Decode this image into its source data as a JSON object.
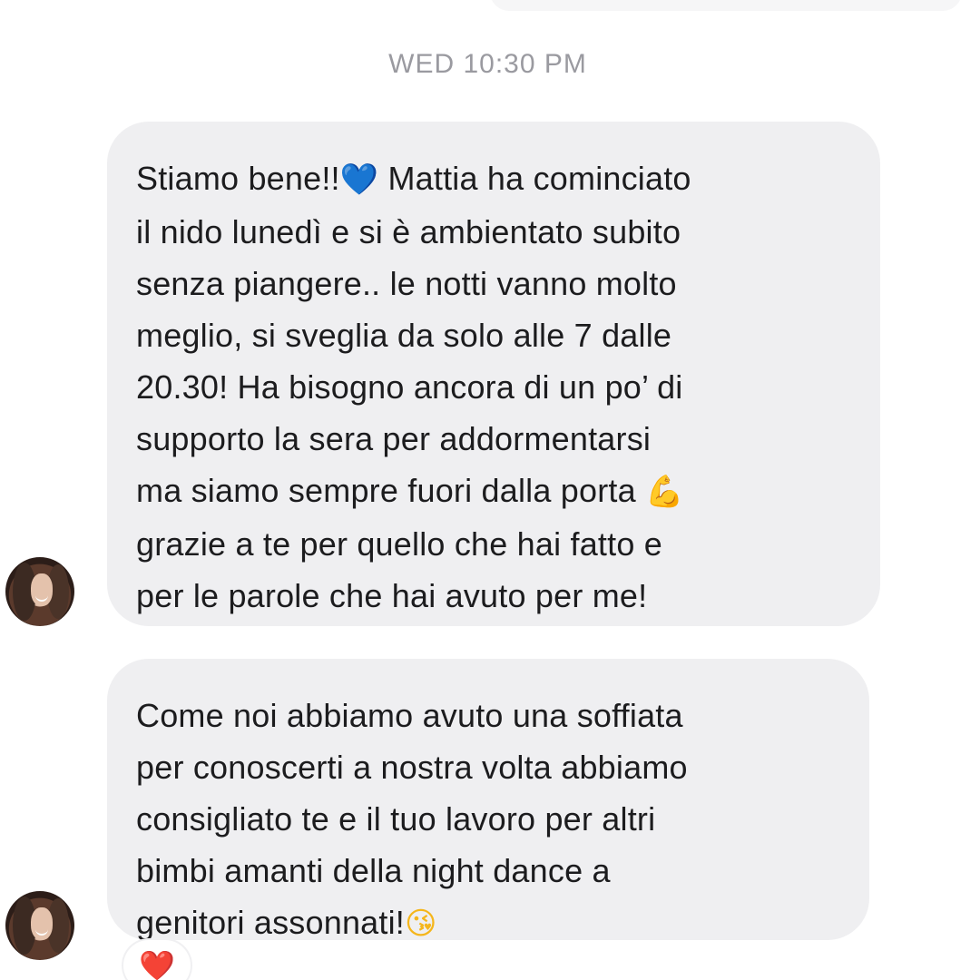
{
  "timestamp": "WED 10:30 PM",
  "messages": [
    {
      "segments": [
        {
          "text": "Stiamo bene!!",
          "type": "text"
        },
        {
          "text": "💙",
          "type": "emoji",
          "icon": "blue-heart-icon"
        },
        {
          "text": " Mattia ha cominciato\nil nido lunedì e si è ambientato subito\nsenza piangere.. le notti vanno molto\nmeglio, si sveglia da solo alle 7 dalle\n20.30! Ha bisogno ancora di un po’ di\nsupporto la sera per addormentarsi\nma siamo sempre fuori dalla porta ",
          "type": "text"
        },
        {
          "text": "💪",
          "type": "emoji",
          "icon": "flexed-biceps-icon"
        },
        {
          "text": "\ngrazie a te per quello che hai fatto e\nper le parole che hai avuto per me!",
          "type": "text"
        }
      ]
    },
    {
      "segments": [
        {
          "text": "Come noi abbiamo avuto una soffiata\nper conoscerti a nostra volta abbiamo\nconsigliato te e il tuo lavoro per altri\nbimbi amanti della night dance a\ngenitori assonnati!",
          "type": "text"
        },
        {
          "text": "😘",
          "type": "emoji",
          "icon": "face-blowing-kiss-icon"
        }
      ]
    }
  ],
  "reaction": {
    "emoji": "❤️",
    "icon": "red-heart-icon",
    "color": "#e8323c"
  },
  "colors": {
    "bubble": "#efeff1",
    "text": "#1c1c1e",
    "timestamp": "#9a9aa0",
    "blue_heart": "#1e7cf2"
  }
}
